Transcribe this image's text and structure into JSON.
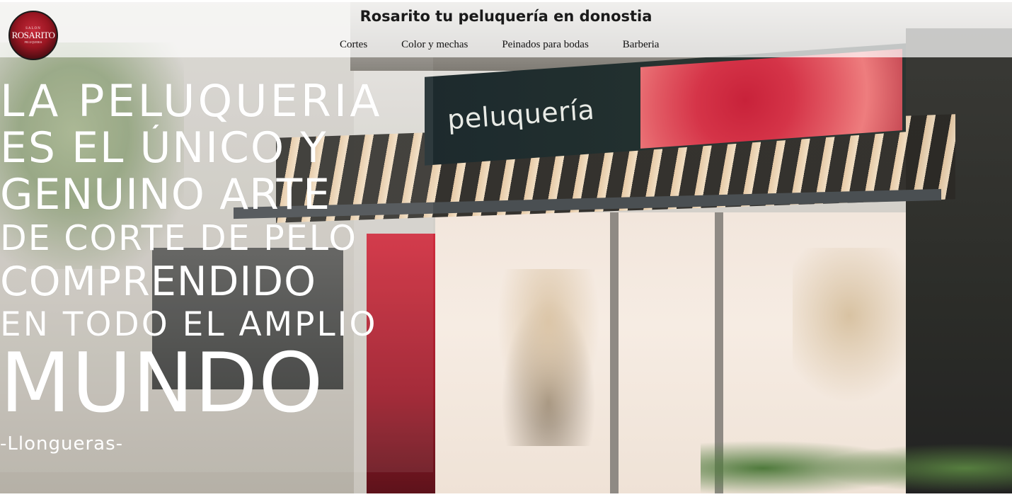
{
  "header": {
    "site_title": "Rosarito tu peluquería en donostia",
    "logo": {
      "top_text": "SALON",
      "name": "ROSARITO",
      "sub_text": "PELUQUERIA"
    },
    "nav": [
      {
        "label": "Cortes"
      },
      {
        "label": "Color y mechas"
      },
      {
        "label": "Peinados para bodas"
      },
      {
        "label": "Barberia"
      }
    ]
  },
  "hero": {
    "sign_text": "peluquería",
    "quote_lines": [
      "La peluqueria",
      "es el único y",
      "genuino arte",
      "de corte de pelo",
      "comprendido",
      "en todo el amplio",
      "mundo"
    ],
    "author": "-Llongueras-"
  },
  "colors": {
    "header_bg": "#ffffff",
    "text_light": "#ffffff",
    "accent_red": "#c62a3a"
  }
}
